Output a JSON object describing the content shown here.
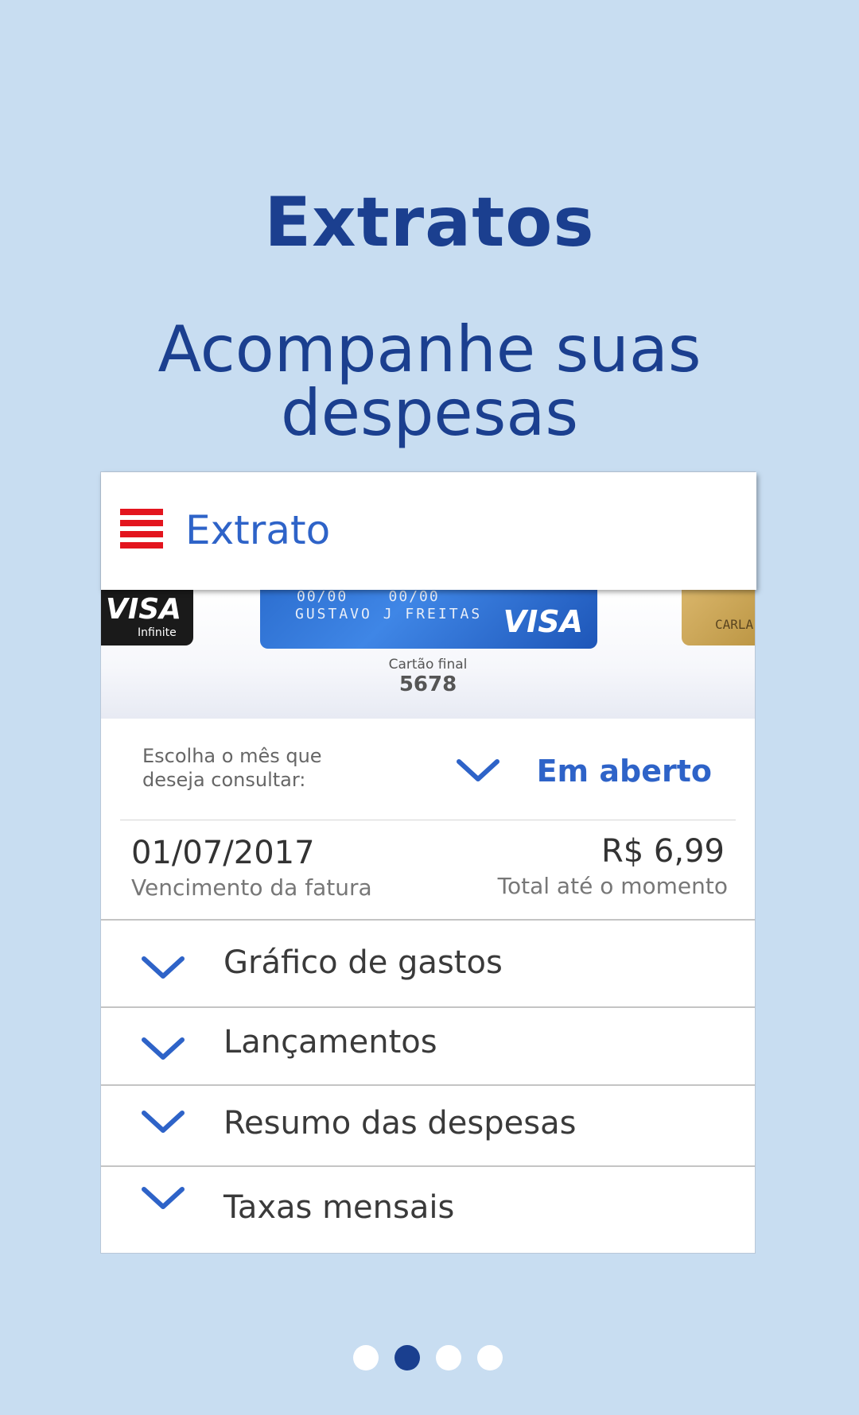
{
  "onboarding": {
    "title": "Extratos",
    "subtitle_line1": "Acompanhe suas",
    "subtitle_line2": "despesas"
  },
  "app_bar": {
    "title": "Extrato",
    "menu_icon": "hamburger-menu-icon",
    "menu_color": "#e3151e",
    "accent_color": "#2e63c8"
  },
  "cards": {
    "left": {
      "brand": "VISA",
      "tier": "Infinite"
    },
    "main": {
      "numbers_left": "00/00",
      "numbers_right": "00/00",
      "holder": "GUSTAVO J FREITAS",
      "brand": "VISA"
    },
    "right": {
      "holder": "CARLA"
    },
    "caption": "Cartão final",
    "last_digits": "5678"
  },
  "month_select": {
    "prompt_line1": "Escolha o mês que",
    "prompt_line2": "deseja consultar:",
    "value": "Em aberto",
    "icon": "chevron-down-icon"
  },
  "invoice": {
    "due_date": "01/07/2017",
    "due_date_label": "Vencimento da fatura",
    "total": "R$ 6,99",
    "total_label": "Total até o momento"
  },
  "sections": [
    {
      "label": "Gráfico de gastos"
    },
    {
      "label": "Lançamentos"
    },
    {
      "label": "Resumo das despesas"
    },
    {
      "label": "Taxas mensais"
    }
  ],
  "pager": {
    "pages": 4,
    "current": 2
  },
  "colors": {
    "background": "#c8ddf1",
    "heading": "#1b3f8f",
    "chevron": "#2e63c8",
    "pager_active": "#1a3f8f"
  }
}
